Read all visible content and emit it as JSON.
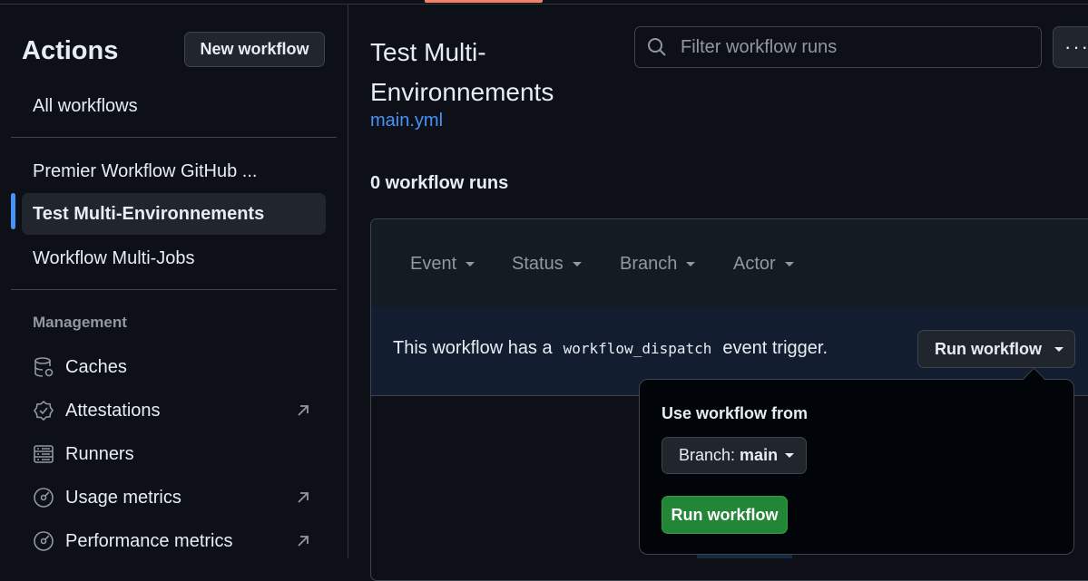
{
  "sidebar": {
    "title": "Actions",
    "new_workflow": "New workflow",
    "all_workflows": "All workflows",
    "workflows": [
      {
        "label": "Premier Workflow GitHub ..."
      },
      {
        "label": "Test Multi-Environnements"
      },
      {
        "label": "Workflow Multi-Jobs"
      }
    ],
    "management_heading": "Management",
    "management": [
      {
        "label": "Caches",
        "icon": "database-icon"
      },
      {
        "label": "Attestations",
        "icon": "verified-badge-icon"
      },
      {
        "label": "Runners",
        "icon": "server-icon"
      },
      {
        "label": "Usage metrics",
        "icon": "meter-icon"
      },
      {
        "label": "Performance metrics",
        "icon": "meter-icon"
      }
    ]
  },
  "main": {
    "title": "Test Multi-Environnements",
    "file": "main.yml",
    "runs_count": "0 workflow runs",
    "filter_placeholder": "Filter workflow runs",
    "more": "···",
    "filters": [
      "Event",
      "Status",
      "Branch",
      "Actor"
    ],
    "dispatch": {
      "prefix": "This workflow has a",
      "code": "workflow_dispatch",
      "suffix": "event trigger.",
      "run_button": "Run workflow"
    }
  },
  "dropdown": {
    "title": "Use workflow from",
    "branch_label": "Branch:",
    "branch_value": "main",
    "run_button": "Run workflow"
  },
  "colors": {
    "background": "#0d1117",
    "link": "#4493f8",
    "primary_button": "#238636",
    "accent": "#f78166"
  }
}
